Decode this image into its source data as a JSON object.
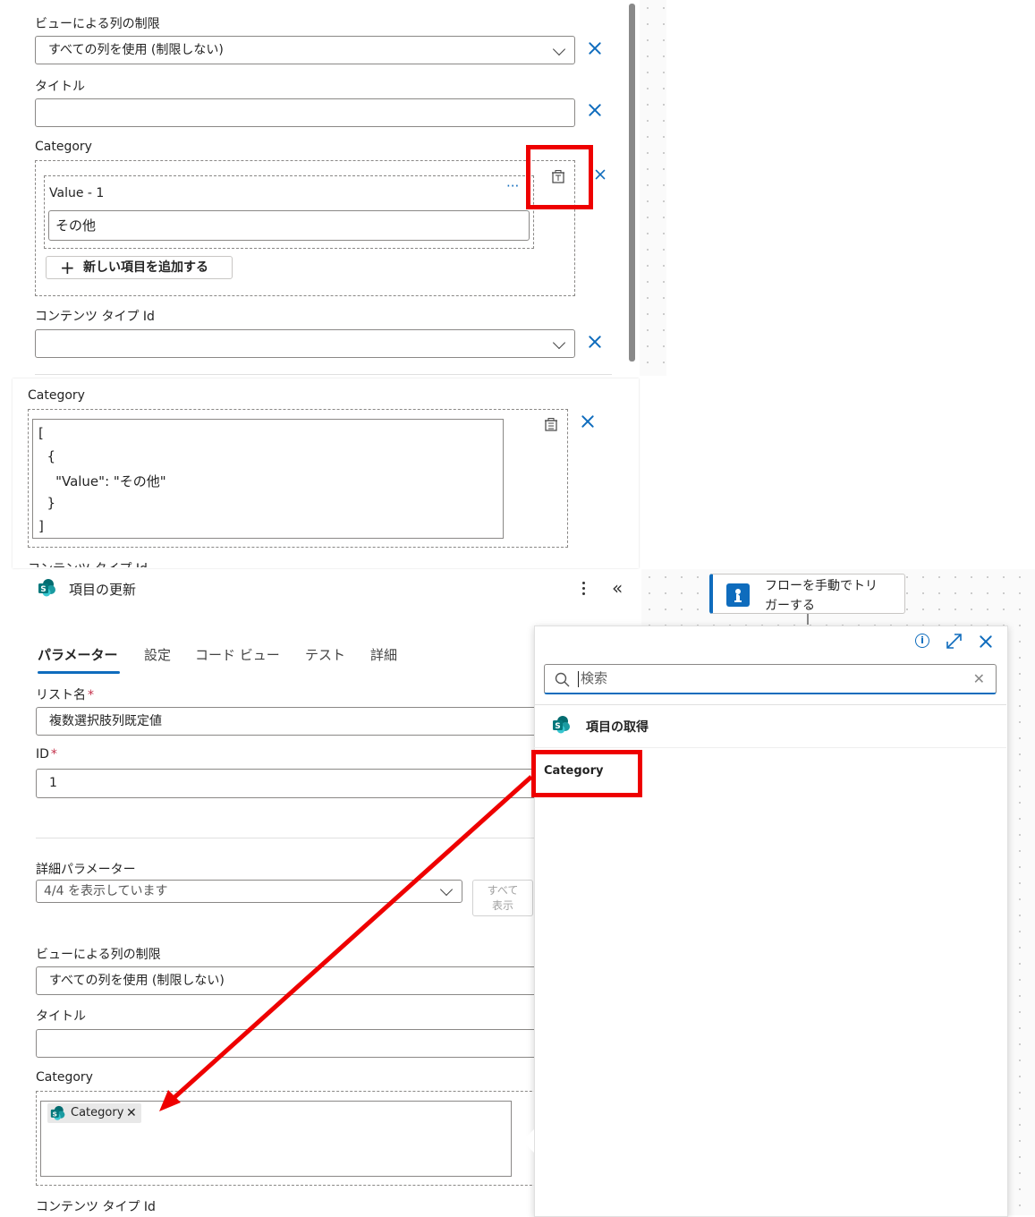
{
  "top_panel": {
    "view_limit_label": "ビューによる列の制限",
    "view_limit_value": "すべての列を使用 (制限しない)",
    "title_label": "タイトル",
    "category_label": "Category",
    "value_item_label": "Value - 1",
    "value_item_more": "···",
    "value_item_value": "その他",
    "add_item_button": "新しい項目を追加する",
    "content_type_label": "コンテンツ タイプ Id"
  },
  "middle_panel": {
    "category_label": "Category",
    "json_lines": [
      "[",
      "  {",
      "    \"Value\": \"その他\"",
      "  }",
      "]"
    ],
    "cut_label": "コンテンツ タイプ Id"
  },
  "bottom_panel": {
    "action_title": "項目の更新",
    "tabs": [
      "パラメーター",
      "設定",
      "コード ビュー",
      "テスト",
      "詳細"
    ],
    "list_name_label": "リスト名",
    "list_name_value": "複数選択肢列既定値",
    "id_label": "ID",
    "id_value": "1",
    "advanced_label": "詳細パラメーター",
    "advanced_value": "4/4 を表示しています",
    "show_all_line1": "すべて",
    "show_all_line2": "表示",
    "view_limit_label": "ビューによる列の制限",
    "view_limit_value": "すべての列を使用 (制限しない)",
    "title_label": "タイトル",
    "category_label": "Category",
    "category_token": "Category",
    "content_type_label": "コンテンツ タイプ Id"
  },
  "flow_node": {
    "line1": "フローを手動でトリ",
    "line2": "ガーする"
  },
  "dynamic_panel": {
    "search_placeholder": "検索",
    "group_title": "項目の取得",
    "item": "Category"
  },
  "colors": {
    "accent": "#0f6cbd",
    "highlight": "#ee0000",
    "sharepoint": "#038387"
  }
}
